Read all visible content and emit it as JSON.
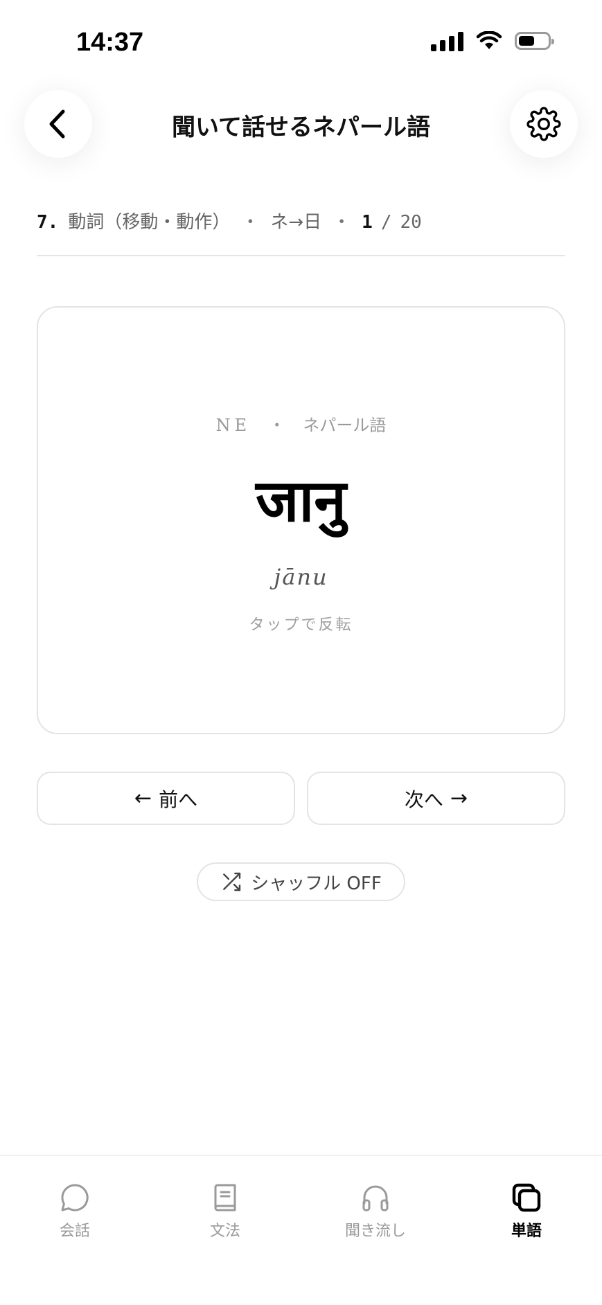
{
  "status_bar": {
    "time": "14:37"
  },
  "header": {
    "title": "聞いて話せるネパール語",
    "back_icon": "chevron-left-icon",
    "settings_icon": "gear-icon"
  },
  "breadcrumb": {
    "lesson_number": "7.",
    "lesson_name": "動詞（移動・動作）",
    "separator": "・",
    "direction": "ネ→日",
    "current": "1",
    "slash": "/",
    "total": "20"
  },
  "card": {
    "lang_code": "NE",
    "lang_separator": "・",
    "lang_name": "ネパール語",
    "word": "जानु",
    "transliteration": "jānu",
    "hint": "タップで反転"
  },
  "nav": {
    "prev_label": "前へ",
    "prev_arrow": "←",
    "next_label": "次へ",
    "next_arrow": "→"
  },
  "shuffle": {
    "label": "シャッフル OFF",
    "icon": "shuffle-icon"
  },
  "tabs": [
    {
      "label": "会話",
      "icon": "chat-bubble-icon",
      "active": false
    },
    {
      "label": "文法",
      "icon": "book-icon",
      "active": false
    },
    {
      "label": "聞き流し",
      "icon": "headphones-icon",
      "active": false
    },
    {
      "label": "単語",
      "icon": "cards-icon",
      "active": true
    }
  ],
  "colors": {
    "accent": "#000000",
    "inactive": "#9a9a9a",
    "border": "#e4e4e4"
  }
}
